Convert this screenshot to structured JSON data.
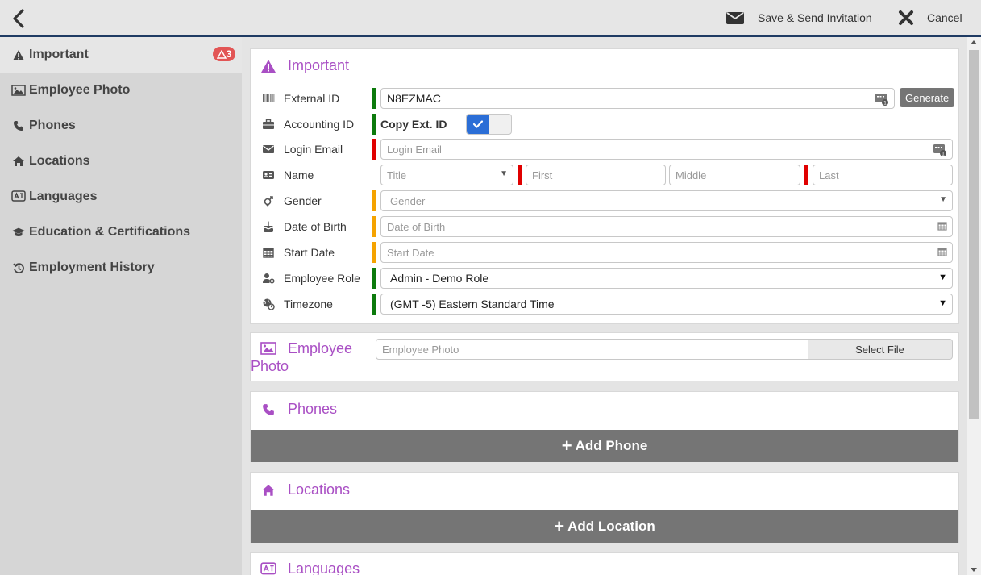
{
  "colors": {
    "accent": "#a94fc4",
    "required_green": "#0c7a0c",
    "required_red": "#e00000",
    "required_orange": "#f5a300",
    "badge": "#e25555",
    "toggle": "#2b6ed6"
  },
  "topbar": {
    "save_label": "Save & Send Invitation",
    "cancel_label": "Cancel"
  },
  "sidebar": {
    "items": [
      {
        "label": "Important",
        "icon": "warning-icon",
        "badge": "3"
      },
      {
        "label": "Employee Photo",
        "icon": "image-icon"
      },
      {
        "label": "Phones",
        "icon": "phone-icon"
      },
      {
        "label": "Locations",
        "icon": "home-icon"
      },
      {
        "label": "Languages",
        "icon": "language-icon"
      },
      {
        "label": "Education & Certifications",
        "icon": "graduation-cap-icon"
      },
      {
        "label": "Employment History",
        "icon": "history-icon"
      }
    ]
  },
  "important": {
    "title": "Important",
    "external_id": {
      "label": "External ID",
      "value": "N8EZMAC",
      "generate_label": "Generate"
    },
    "accounting_id": {
      "label": "Accounting ID",
      "copy_label": "Copy Ext. ID",
      "checked": true
    },
    "login_email": {
      "label": "Login Email",
      "placeholder": "Login Email"
    },
    "name": {
      "label": "Name",
      "title_placeholder": "Title",
      "first_placeholder": "First",
      "middle_placeholder": "Middle",
      "last_placeholder": "Last"
    },
    "gender": {
      "label": "Gender",
      "placeholder": "Gender"
    },
    "dob": {
      "label": "Date of Birth",
      "placeholder": "Date of Birth"
    },
    "start_date": {
      "label": "Start Date",
      "placeholder": "Start Date"
    },
    "role": {
      "label": "Employee Role",
      "value": "Admin - Demo Role"
    },
    "timezone": {
      "label": "Timezone",
      "value": "(GMT -5) Eastern Standard Time"
    }
  },
  "photo": {
    "title_line1": "Employee",
    "title_line2": "Photo",
    "placeholder": "Employee Photo",
    "select_label": "Select File"
  },
  "phones": {
    "title": "Phones",
    "add_label": "Add Phone"
  },
  "locations": {
    "title": "Locations",
    "add_label": "Add Location"
  },
  "languages": {
    "title": "Languages"
  }
}
